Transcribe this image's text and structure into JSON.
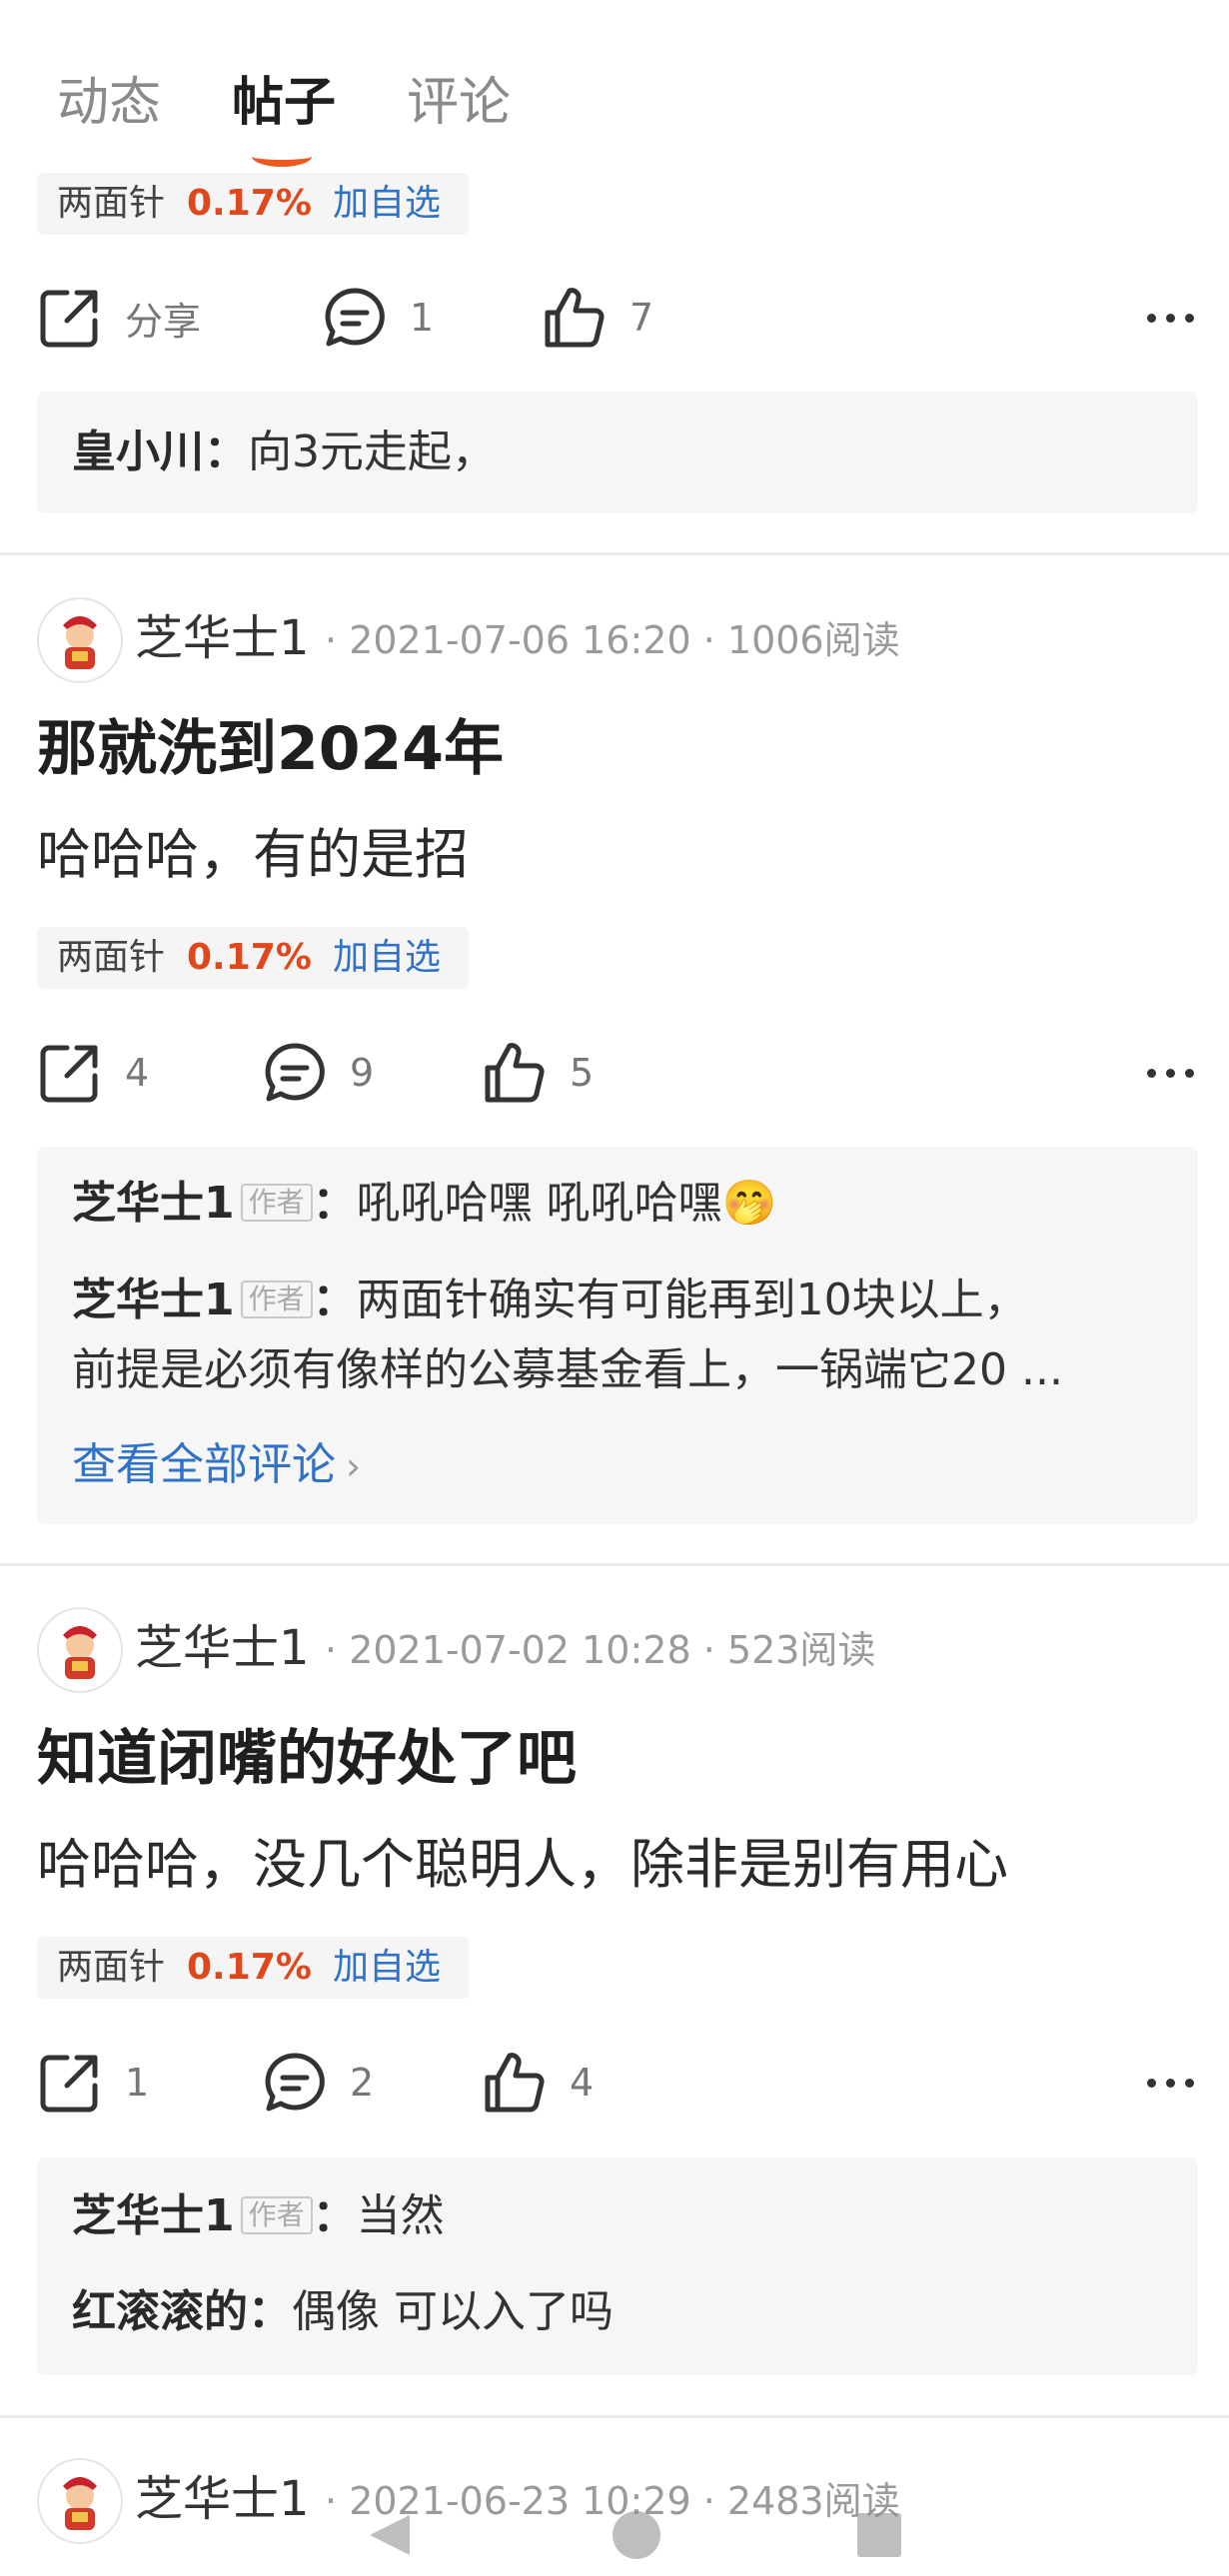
{
  "tabs": [
    {
      "label": "动态"
    },
    {
      "label": "帖子"
    },
    {
      "label": "评论"
    }
  ],
  "stock": {
    "name": "两面针",
    "change": "0.17%",
    "watch_label": "加自选"
  },
  "post0": {
    "share_label": "分享",
    "comments": "1",
    "likes": "7",
    "comment": {
      "author": "皇小川：",
      "text": "向3元走起，"
    }
  },
  "post1": {
    "author": "芝华士1",
    "time": "2021-07-06 16:20",
    "reads": "1006阅读",
    "title": "那就洗到2024年",
    "body": "哈哈哈，有的是招",
    "shares": "4",
    "comments": "9",
    "likes": "5",
    "comment_list": [
      {
        "author": "芝华士1",
        "badge": "作者",
        "text": "吼吼哈嘿 吼吼哈嘿🤭"
      },
      {
        "author": "芝华士1",
        "badge": "作者",
        "text": "两面针确实有可能再到10块以上，",
        "text2": "前提是必须有像样的公募基金看上，一锅端它20 ..."
      }
    ],
    "view_all": "查看全部评论"
  },
  "post2": {
    "author": "芝华士1",
    "time": "2021-07-02 10:28",
    "reads": "523阅读",
    "title": "知道闭嘴的好处了吧",
    "body": "哈哈哈，没几个聪明人，除非是别有用心",
    "shares": "1",
    "comments": "2",
    "likes": "4",
    "comment_list": [
      {
        "author": "芝华士1",
        "badge": "作者",
        "text": "当然"
      },
      {
        "author": "红滚滚的：",
        "text": "偶像 可以入了吗"
      }
    ]
  },
  "post3": {
    "author": "芝华士1",
    "time": "2021-06-23 10:29",
    "reads": "2483阅读"
  },
  "icons": {
    "share": "share-icon",
    "comment": "comment-bubble-icon",
    "like": "thumbs-up-icon",
    "more": "more-dots-icon"
  },
  "colors": {
    "accent": "#f0581e",
    "stock_up": "#e0481c",
    "link": "#2f72c8"
  }
}
